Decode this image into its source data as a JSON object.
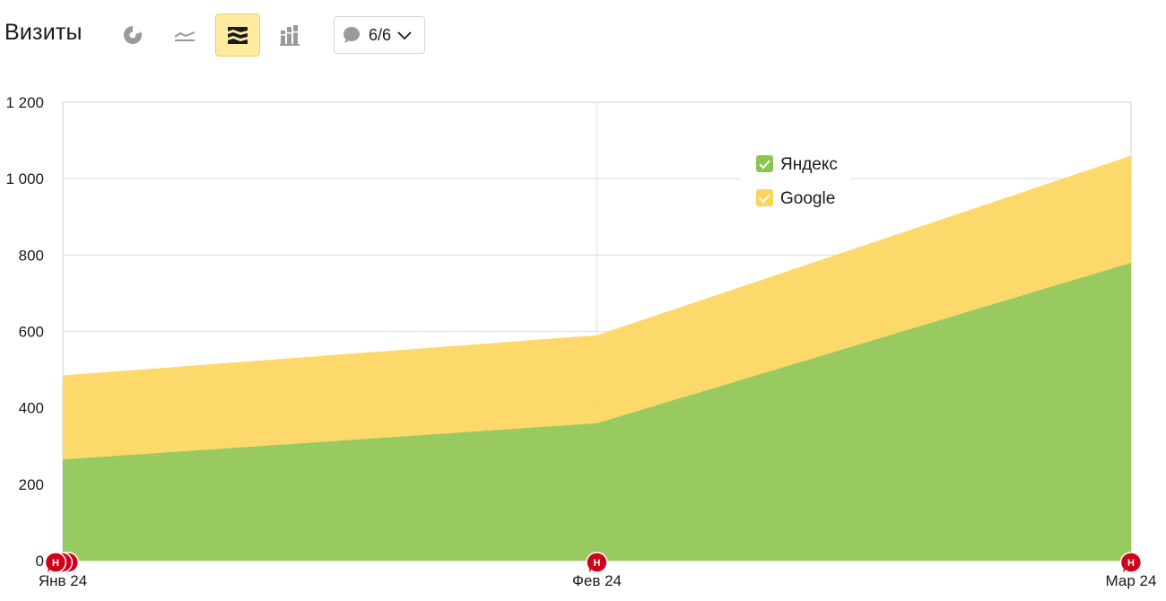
{
  "header": {
    "title": "Визиты",
    "notes_count": "6/6"
  },
  "toolbar_icons": [
    "pie-chart-icon",
    "line-chart-icon",
    "area-chart-icon",
    "column-chart-icon"
  ],
  "colors": {
    "yandex": "#8dc44f",
    "google": "#fdd45a",
    "grid": "#e4e4e4",
    "active_tool_bg": "#ffeba0",
    "note_marker": "#d0021b"
  },
  "chart_data": {
    "type": "area",
    "stacked": true,
    "x": [
      "Янв 24",
      "Фев 24",
      "Мар 24"
    ],
    "series": [
      {
        "name": "Яндекс",
        "values": [
          265,
          360,
          780
        ]
      },
      {
        "name": "Google",
        "values": [
          220,
          230,
          280
        ]
      }
    ],
    "ylim": [
      0,
      1200
    ],
    "yticks": [
      "0",
      "200",
      "400",
      "600",
      "800",
      "1 000",
      "1 200"
    ],
    "ytick_values": [
      0,
      200,
      400,
      600,
      800,
      1000,
      1200
    ],
    "grid": true,
    "legend": "top-right",
    "note_markers": [
      {
        "x_index": 0,
        "label": "Н",
        "count": 3
      },
      {
        "x_index": 1,
        "label": "Н",
        "count": 1
      },
      {
        "x_index": 2,
        "label": "Н",
        "count": 1
      }
    ]
  }
}
